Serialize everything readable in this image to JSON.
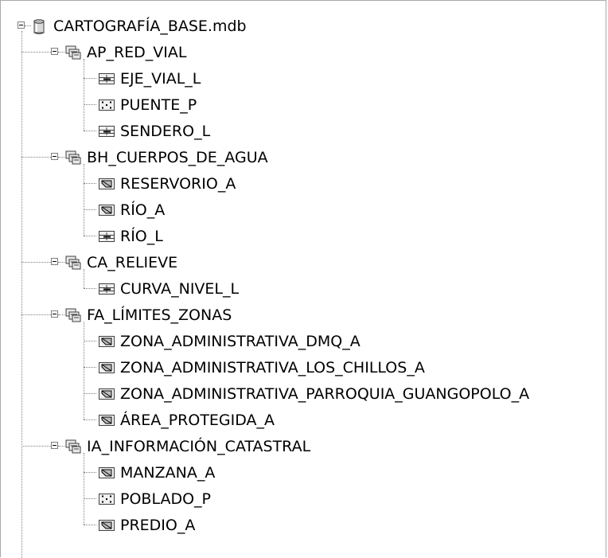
{
  "tree": {
    "database": {
      "label": "CARTOGRAFÍA_BASE.mdb",
      "icon": "database-icon"
    },
    "datasets": [
      {
        "label": "AP_RED_VIAL",
        "icon": "feature-dataset-icon",
        "classes": [
          {
            "label": "EJE_VIAL_L",
            "icon": "line-feature-class-icon"
          },
          {
            "label": "PUENTE_P",
            "icon": "point-feature-class-icon"
          },
          {
            "label": "SENDERO_L",
            "icon": "line-feature-class-icon"
          }
        ]
      },
      {
        "label": "BH_CUERPOS_DE_AGUA",
        "icon": "feature-dataset-icon",
        "classes": [
          {
            "label": "RESERVORIO_A",
            "icon": "polygon-feature-class-icon"
          },
          {
            "label": "RÍO_A",
            "icon": "polygon-feature-class-icon"
          },
          {
            "label": "RÍO_L",
            "icon": "line-feature-class-icon"
          }
        ]
      },
      {
        "label": "CA_RELIEVE",
        "icon": "feature-dataset-icon",
        "classes": [
          {
            "label": "CURVA_NIVEL_L",
            "icon": "line-feature-class-icon"
          }
        ]
      },
      {
        "label": "FA_LÍMITES_ZONAS",
        "icon": "feature-dataset-icon",
        "classes": [
          {
            "label": "ZONA_ADMINISTRATIVA_DMQ_A",
            "icon": "polygon-feature-class-icon"
          },
          {
            "label": "ZONA_ADMINISTRATIVA_LOS_CHILLOS_A",
            "icon": "polygon-feature-class-icon"
          },
          {
            "label": "ZONA_ADMINISTRATIVA_PARROQUIA_GUANGOPOLO_A",
            "icon": "polygon-feature-class-icon"
          },
          {
            "label": "ÁREA_PROTEGIDA_A",
            "icon": "polygon-feature-class-icon"
          }
        ]
      },
      {
        "label": "IA_INFORMACIÓN_CATASTRAL",
        "icon": "feature-dataset-icon",
        "classes": [
          {
            "label": "MANZANA_A",
            "icon": "polygon-feature-class-icon"
          },
          {
            "label": "POBLADO_P",
            "icon": "point-feature-class-icon"
          },
          {
            "label": "PREDIO_A",
            "icon": "polygon-feature-class-icon"
          }
        ]
      }
    ]
  }
}
